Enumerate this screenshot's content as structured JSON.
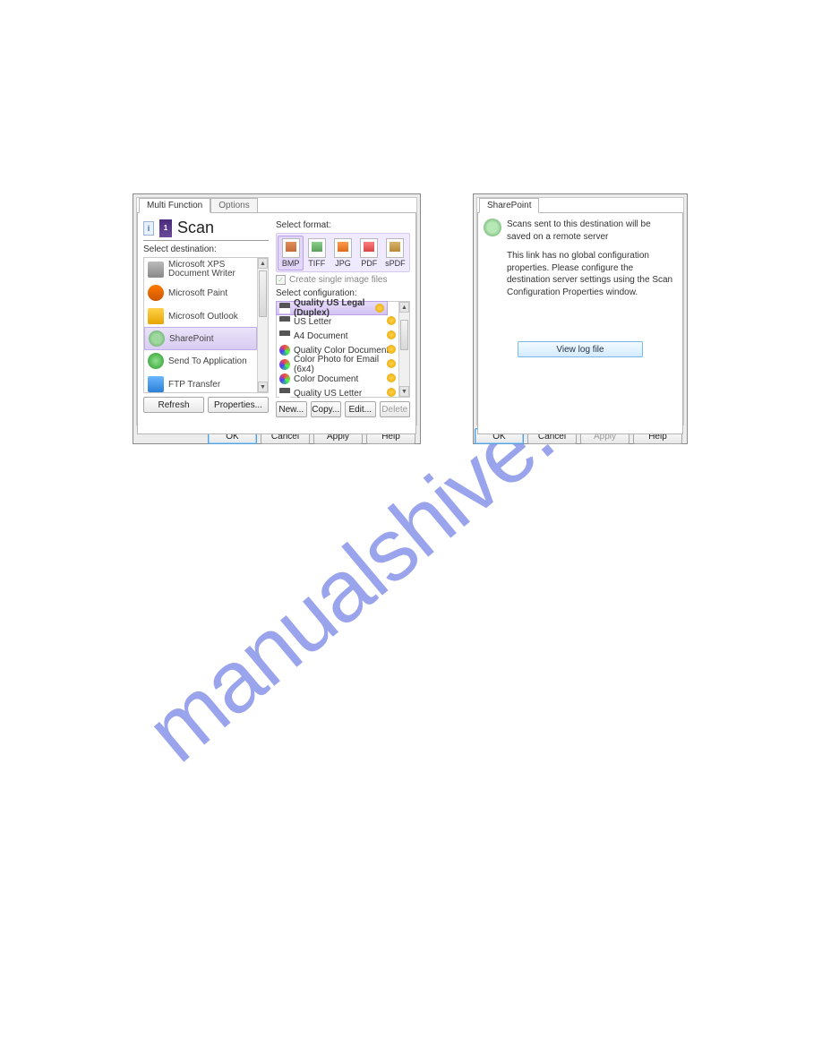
{
  "watermark": "manualshive.com",
  "left": {
    "tabs": [
      "Multi Function",
      "Options"
    ],
    "scan_title": "Scan",
    "select_destination_label": "Select destination:",
    "destinations": [
      {
        "label": "Microsoft XPS Document Writer",
        "icon": "printer"
      },
      {
        "label": "Microsoft Paint",
        "icon": "paint"
      },
      {
        "label": "Microsoft Outlook",
        "icon": "outlook"
      },
      {
        "label": "SharePoint",
        "icon": "sharepoint",
        "selected": true
      },
      {
        "label": "Send To Application",
        "icon": "send"
      },
      {
        "label": "FTP Transfer",
        "icon": "ftp"
      }
    ],
    "dest_buttons": {
      "refresh": "Refresh",
      "properties": "Properties..."
    },
    "select_format_label": "Select format:",
    "formats": [
      {
        "label": "BMP",
        "selected": true
      },
      {
        "label": "TIFF"
      },
      {
        "label": "JPG"
      },
      {
        "label": "PDF"
      },
      {
        "label": "sPDF"
      }
    ],
    "create_single_label": "Create single image files",
    "create_single_checked": true,
    "select_config_label": "Select configuration:",
    "configs": [
      {
        "label": "Quality US Legal (Duplex)",
        "type": "bw",
        "locked": true,
        "selected": true
      },
      {
        "label": "US Letter",
        "type": "bw",
        "locked": true
      },
      {
        "label": "A4 Document",
        "type": "bw",
        "locked": true
      },
      {
        "label": "Quality Color Document",
        "type": "col",
        "locked": true
      },
      {
        "label": "Color Photo for Email (6x4)",
        "type": "col",
        "locked": true
      },
      {
        "label": "Color Document",
        "type": "col",
        "locked": true
      },
      {
        "label": "Quality US Letter",
        "type": "bw",
        "locked": true
      }
    ],
    "config_buttons": {
      "new": "New...",
      "copy": "Copy...",
      "edit": "Edit...",
      "delete": "Delete"
    },
    "bottom_buttons": {
      "ok": "OK",
      "cancel": "Cancel",
      "apply": "Apply",
      "help": "Help"
    }
  },
  "right": {
    "tab": "SharePoint",
    "message": "Scans sent to this destination will be saved on a remote server",
    "note": "This link has no global configuration properties. Please configure the destination server settings using the Scan Configuration Properties window.",
    "view_log": "View log file",
    "bottom_buttons": {
      "ok": "OK",
      "cancel": "Cancel",
      "apply": "Apply",
      "help": "Help"
    }
  }
}
